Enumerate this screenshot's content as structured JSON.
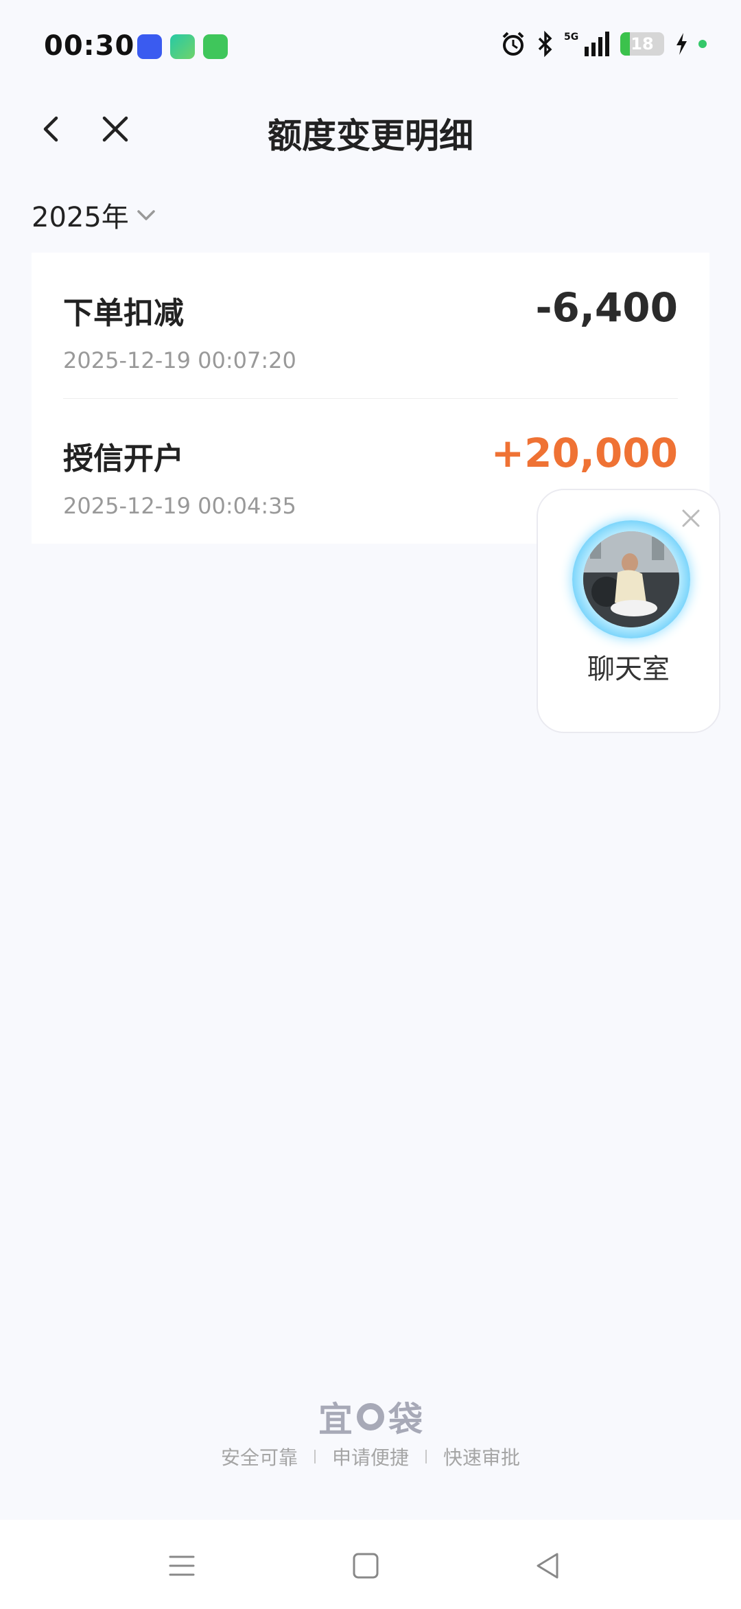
{
  "status_bar": {
    "time": "00:30",
    "network": "5G",
    "battery": "18"
  },
  "header": {
    "title": "额度变更明细"
  },
  "filter": {
    "year": "2025年"
  },
  "records": [
    {
      "title": "下单扣减",
      "datetime": "2025-12-19 00:07:20",
      "amount": "-6,400"
    },
    {
      "title": "授信开户",
      "datetime": "2025-12-19 00:04:35",
      "amount": "+20,000"
    }
  ],
  "chat_widget": {
    "label": "聊天室"
  },
  "footer": {
    "brand_chars": [
      "宜",
      "袋"
    ],
    "slogans": [
      "安全可靠",
      "申请便捷",
      "快速审批"
    ]
  },
  "colors": {
    "positive_amount": "#ef7234",
    "negative_amount": "#2b2b2b",
    "background": "#f8f9fd"
  }
}
